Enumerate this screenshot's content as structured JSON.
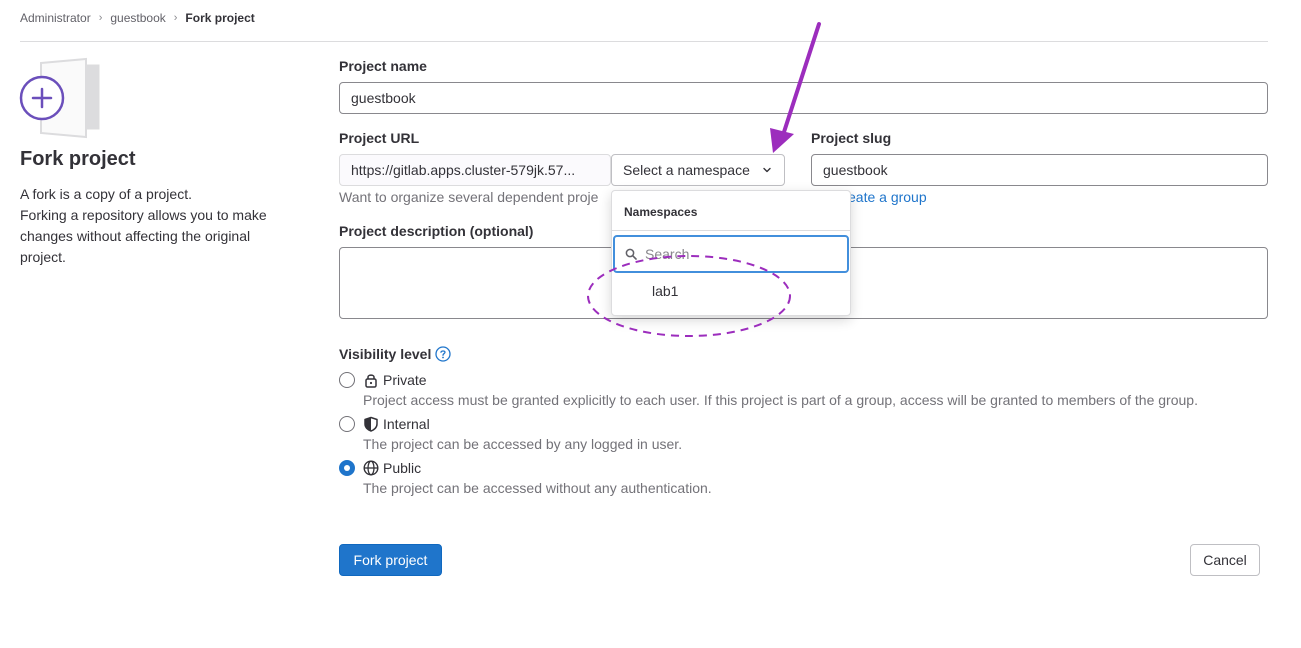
{
  "breadcrumb": {
    "items": [
      "Administrator",
      "guestbook"
    ],
    "current": "Fork project"
  },
  "sidebar": {
    "title": "Fork project",
    "description_lines": [
      "A fork is a copy of a project.",
      "Forking a repository allows you to make",
      "changes without affecting the original",
      "project."
    ]
  },
  "form": {
    "project_name_label": "Project name",
    "project_name_value": "guestbook",
    "project_url_label": "Project URL",
    "project_url_prefix": "https://gitlab.apps.cluster-579jk.57...",
    "namespace_button": "Select a namespace",
    "project_slug_label": "Project slug",
    "project_slug_value": "guestbook",
    "url_help_prefix": "Want to organize several dependent proje",
    "url_help_link": "eate a group",
    "description_label": "Project description (optional)",
    "description_value": ""
  },
  "namespace_dropdown": {
    "header": "Namespaces",
    "search_placeholder": "Search",
    "items": [
      "lab1"
    ]
  },
  "visibility": {
    "label": "Visibility level",
    "options": [
      {
        "label": "Private",
        "help": "Project access must be granted explicitly to each user. If this project is part of a group, access will be granted to members of the group.",
        "checked": false,
        "icon": "lock-icon"
      },
      {
        "label": "Internal",
        "help": "The project can be accessed by any logged in user.",
        "checked": false,
        "icon": "shield-icon"
      },
      {
        "label": "Public",
        "help": "The project can be accessed without any authentication.",
        "checked": true,
        "icon": "globe-icon"
      }
    ]
  },
  "actions": {
    "fork_label": "Fork project",
    "cancel_label": "Cancel"
  },
  "colors": {
    "primary": "#1f75cb",
    "annotation": "#9c2dbd",
    "illustration_accent": "#6b4fbb"
  }
}
